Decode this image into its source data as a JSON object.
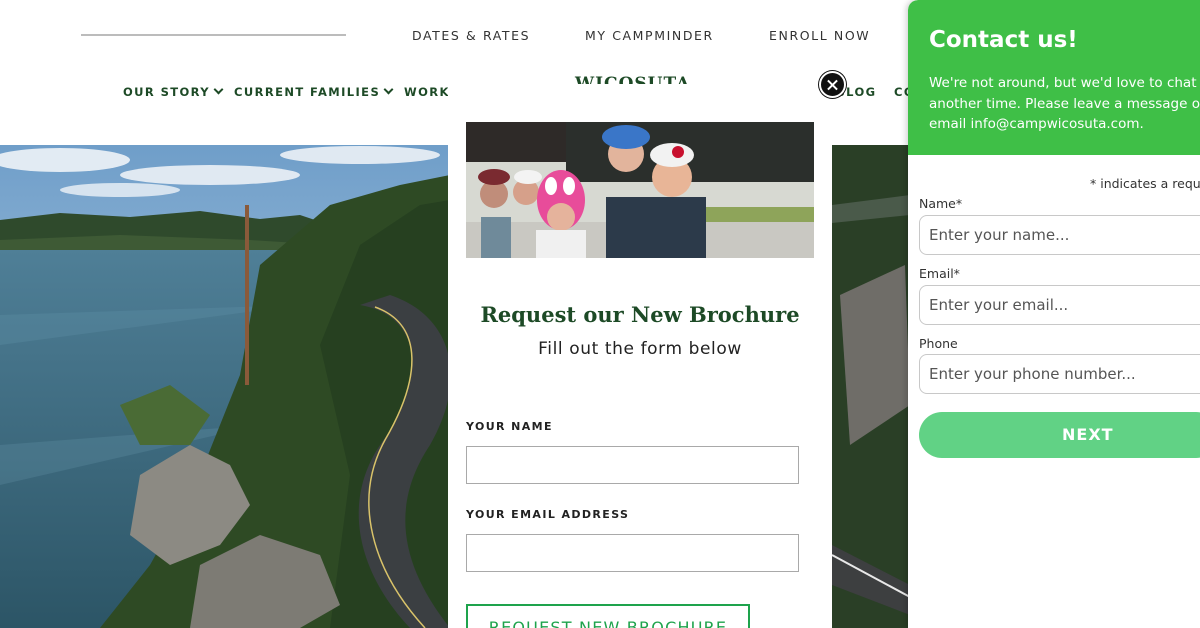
{
  "header": {
    "top_links": [
      "DATES & RATES",
      "MY CAMPMINDER",
      "ENROLL NOW"
    ],
    "nav": {
      "our_story": "OUR STORY",
      "current_families": "CURRENT FAMILIES",
      "work": "WORK",
      "blog": "BLOG",
      "contact": "CO"
    },
    "logo_text": "WICOSUTA"
  },
  "modal": {
    "title": "Request our New Brochure",
    "subtitle": "Fill out the form below",
    "name_label": "YOUR NAME",
    "email_label": "YOUR EMAIL ADDRESS",
    "button_label": "REQUEST NEW BROCHURE"
  },
  "widget": {
    "title": "Contact us!",
    "message": "We're not around, but we'd love to chat another time. Please leave a message or email info@campwicosuta.com.",
    "required_note": "* indicates a required field",
    "name_label": "Name*",
    "name_placeholder": "Enter your name...",
    "email_label": "Email*",
    "email_placeholder": "Enter your email...",
    "phone_label": "Phone",
    "phone_placeholder": "Enter your phone number...",
    "next_label": "NEXT",
    "header_color": "#3fbf47",
    "button_color": "#61d285"
  },
  "colors": {
    "brand_green": "#1d4a26",
    "accent_green": "#1ea34c"
  }
}
